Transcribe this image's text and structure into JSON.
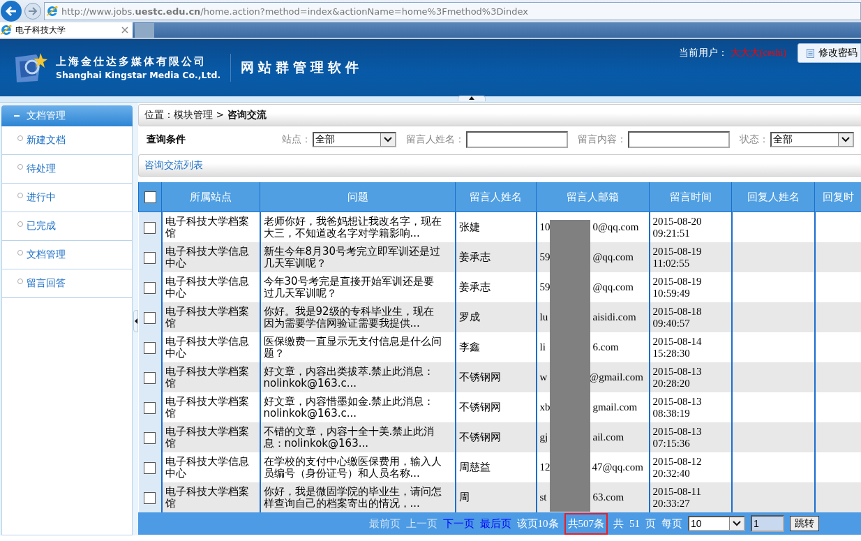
{
  "browser": {
    "url": "http://www.jobs.**uestc.edu.cn**/home.action?method=index&actionName=home%3Fmethod%3Dindex",
    "tab_title": "电子科技大学"
  },
  "header": {
    "company_cn": "上海金仕达多媒体有限公司",
    "company_en": "Shanghai Kingstar Media Co.,Ltd.",
    "product": "网站群管理软件",
    "user_label": "当前用户：",
    "user_name": "大大大(ceshi)",
    "change_password": "修改密码"
  },
  "sidebar": {
    "title": "文档管理",
    "items": [
      {
        "label": "新建文档"
      },
      {
        "label": "待处理"
      },
      {
        "label": "进行中"
      },
      {
        "label": "已完成"
      },
      {
        "label": "文档管理"
      },
      {
        "label": "留言回答"
      }
    ]
  },
  "breadcrumb": "位置：模块管理 > **咨询交流**",
  "query": {
    "title": "查询条件",
    "fields": [
      {
        "kind": "select",
        "label": "站点：",
        "value": "全部"
      },
      {
        "kind": "text",
        "label": "留言人姓名："
      },
      {
        "kind": "text",
        "label": "留言内容："
      },
      {
        "kind": "select",
        "label": "状态：",
        "value": "全部"
      }
    ]
  },
  "list_title": "咨询交流列表",
  "table": {
    "all_checked": false,
    "columns": [
      "所属站点",
      "问题",
      "留言人姓名",
      "留言人邮箱",
      "留言时间",
      "回复人姓名",
      "回复时"
    ],
    "rows": [
      {
        "checked": false,
        "site": "电子科技大学档案馆",
        "question": "老师你好，我爸妈想让我改名字，现在大三，不知道改名字对学籍影响...",
        "name": "张婕",
        "email_start": "10",
        "email_end": "0@qq.com",
        "time": "2015-08-20 09:21:51"
      },
      {
        "checked": false,
        "site": "电子科技大学信息中心",
        "question": "新生今年8月30号考完立即军训还是过几天军训呢？",
        "name": "姜承志",
        "email_start": "59",
        "email_end": "@qq.com",
        "time": "2015-08-19 11:02:55"
      },
      {
        "checked": false,
        "site": "电子科技大学信息中心",
        "question": "今年30号考完是直接开始军训还是要过几天军训呢？",
        "name": "姜承志",
        "email_start": "59",
        "email_end": "@qq.com",
        "time": "2015-08-19 10:59:49"
      },
      {
        "checked": false,
        "site": "电子科技大学档案馆",
        "question": "你好。我是92级的专科毕业生，现在因为需要学信网验证需要我提供...",
        "name": "罗成",
        "email_start": "lu",
        "email_end": "aisidi.com",
        "time": "2015-08-18 09:40:57"
      },
      {
        "checked": false,
        "site": "电子科技大学信息中心",
        "question": "医保缴费一直显示无支付信息是什么问题？",
        "name": "李鑫",
        "email_start": "li",
        "email_end": "6.com",
        "time": "2015-08-14 15:28:30"
      },
      {
        "checked": false,
        "site": "电子科技大学档案馆",
        "question": "好文章，内容出类拔萃.禁止此消息：nolinkok@163.c...",
        "name": "不锈钢网",
        "email_start": "w",
        "email_end": "@gmail.com",
        "time": "2015-08-13 20:28:20"
      },
      {
        "checked": false,
        "site": "电子科技大学档案馆",
        "question": "好文章，内容惜墨如金.禁止此消息：nolinkok@163.c...",
        "name": "不锈钢网",
        "email_start": "xb",
        "email_end": "gmail.com",
        "time": "2015-08-13 08:38:19"
      },
      {
        "checked": false,
        "site": "电子科技大学档案馆",
        "question": "不错的文章，内容十全十美.禁止此消息：nolinkok@163...",
        "name": "不锈钢网",
        "email_start": "gj",
        "email_end": "ail.com",
        "time": "2015-08-13 07:15:36"
      },
      {
        "checked": false,
        "site": "电子科技大学信息中心",
        "question": "在学校的支付中心缴医保费用，输入人员编号（身份证号）和人员名称...",
        "name": "周慈益",
        "email_start": "12",
        "email_end": "47@qq.com",
        "time": "2015-08-12 20:32:40"
      },
      {
        "checked": false,
        "site": "电子科技大学档案馆",
        "question": "你好，我是微固学院的毕业生，请问怎样查询自己的档案寄出的情况，...",
        "name": "周",
        "email_start": "st",
        "email_end": "63.com",
        "time": "2015-08-11 20:33:27"
      }
    ]
  },
  "pagination": {
    "links": [
      {
        "label": "最前页",
        "disabled": true
      },
      {
        "label": "上一页",
        "disabled": true
      },
      {
        "label": "下一页",
        "disabled": false
      },
      {
        "label": "最后页",
        "disabled": false
      }
    ],
    "page_rows": "该页10条",
    "total": {
      "text": "共507条",
      "highlighted": true
    },
    "pages_prefix": "共",
    "pages": "51",
    "pages_suffix": "页",
    "per_page_label": "每页",
    "per_page": "10",
    "page_input": "1",
    "jump": "跳转"
  }
}
